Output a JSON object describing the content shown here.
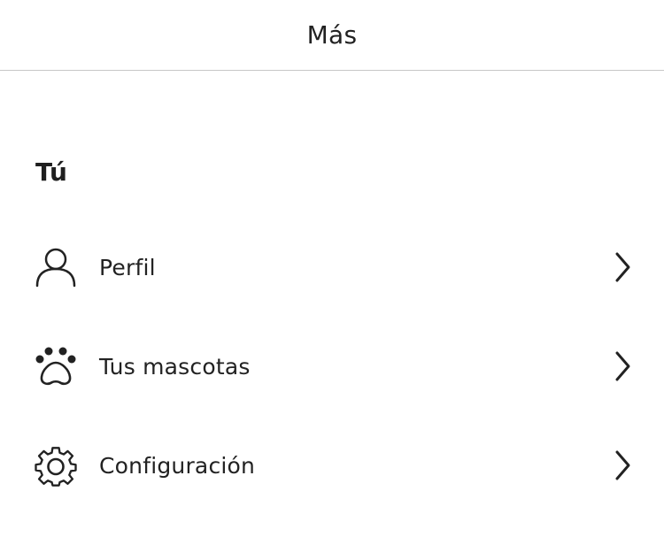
{
  "header": {
    "title": "Más"
  },
  "section": {
    "title": "Tú"
  },
  "menu": {
    "items": [
      {
        "label": "Perfil",
        "icon": "user-icon"
      },
      {
        "label": "Tus mascotas",
        "icon": "paw-icon"
      },
      {
        "label": "Configuración",
        "icon": "gear-icon"
      }
    ]
  },
  "colors": {
    "text": "#222222",
    "divider": "#c8c8c8",
    "background": "#ffffff"
  }
}
